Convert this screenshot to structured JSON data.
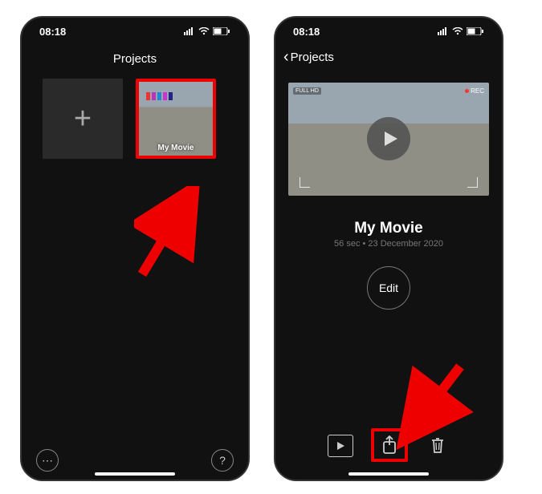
{
  "status": {
    "time": "08:18"
  },
  "left": {
    "header": "Projects",
    "project_label": "My Movie",
    "footer_more": "⋯",
    "footer_help": "?"
  },
  "right": {
    "back_label": "Projects",
    "title": "My Movie",
    "subtitle": "56 sec • 23 December 2020",
    "edit_label": "Edit",
    "preview_badge": "FULL HD",
    "preview_rec": "REC"
  }
}
